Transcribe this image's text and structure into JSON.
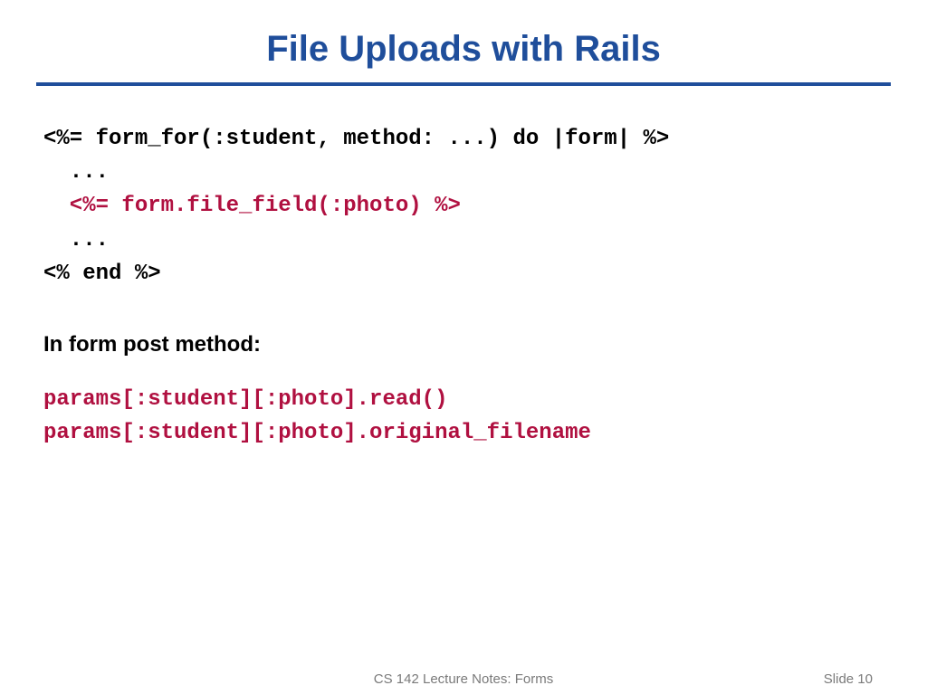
{
  "title": "File Uploads with Rails",
  "code": {
    "line1": "<%= form_for(:student, method: ...) do |form| %>",
    "line2": "  ...",
    "line3": "  <%= form.file_field(:photo) %>",
    "line4": "  ...",
    "line5": "<% end %>"
  },
  "label": "In form post method:",
  "code2": {
    "line1": "params[:student][:photo].read()",
    "line2": "params[:student][:photo].original_filename"
  },
  "footer": {
    "center": "CS 142 Lecture Notes: Forms",
    "right": "Slide 10"
  }
}
